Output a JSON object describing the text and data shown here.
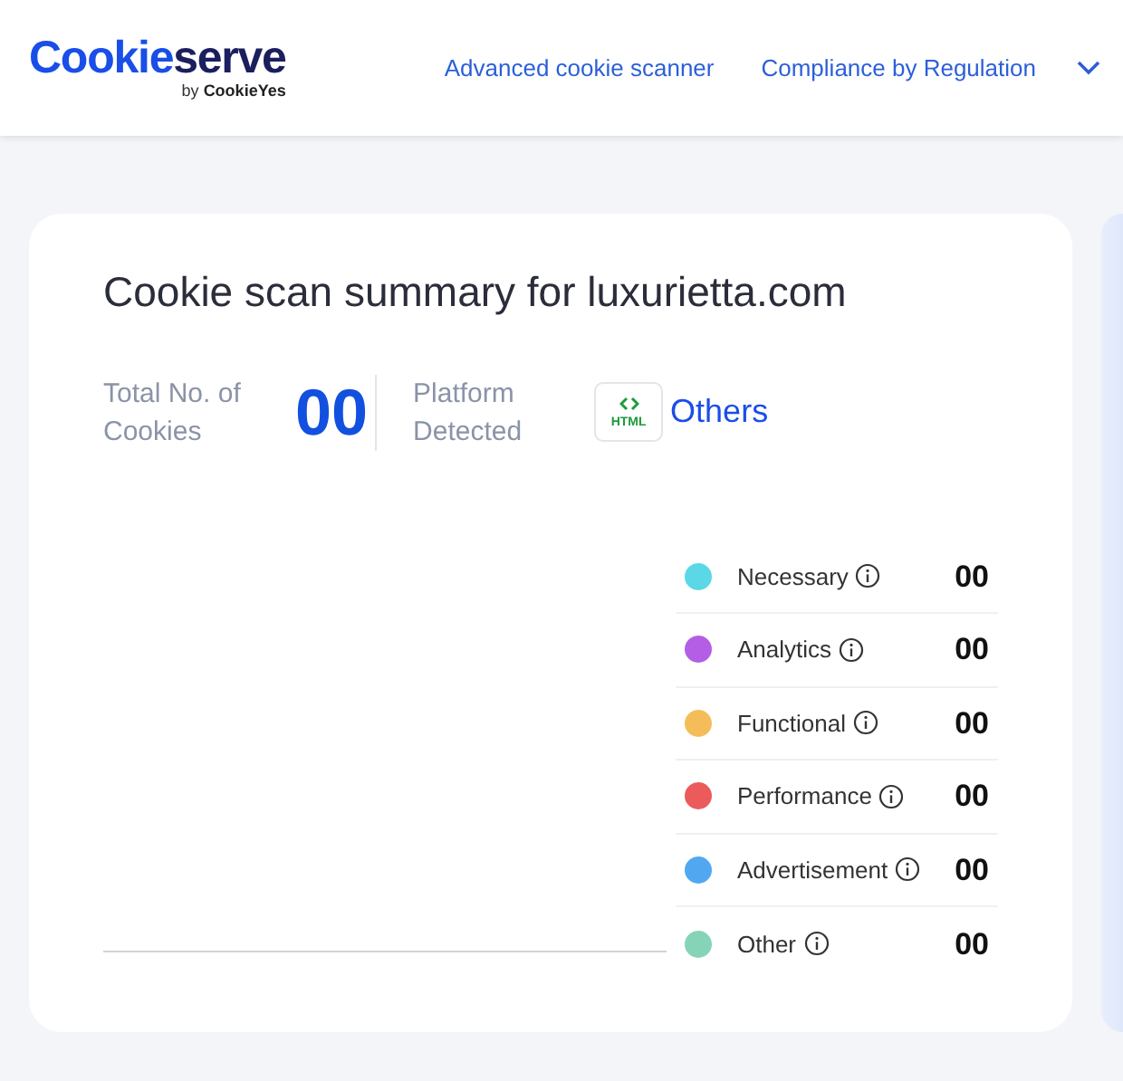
{
  "header": {
    "logo": {
      "brand_part_1": "Cookie",
      "brand_part_2": "serve",
      "byline_prefix": "by",
      "byline_brand": "CookieYes"
    },
    "nav": [
      {
        "label": "Advanced cookie scanner",
        "kind": "link"
      },
      {
        "label": "Compliance by Regulation",
        "kind": "dropdown"
      }
    ]
  },
  "summary": {
    "title": "Cookie scan summary for luxurietta.com",
    "total_label": "Total No. of Cookies",
    "total_value": "00",
    "platform_label": "Platform Detected",
    "platform_badge": "HTML",
    "platform_name": "Others",
    "categories": [
      {
        "name": "Necessary",
        "color": "#5ad8e6",
        "count": "00"
      },
      {
        "name": "Analytics",
        "color": "#b45ee6",
        "count": "00"
      },
      {
        "name": "Functional",
        "color": "#f5bd5a",
        "count": "00"
      },
      {
        "name": "Performance",
        "color": "#eb5b5b",
        "count": "00"
      },
      {
        "name": "Advertisement",
        "color": "#52a8f0",
        "count": "00"
      },
      {
        "name": "Other",
        "color": "#86d4b8",
        "count": "00"
      }
    ]
  }
}
